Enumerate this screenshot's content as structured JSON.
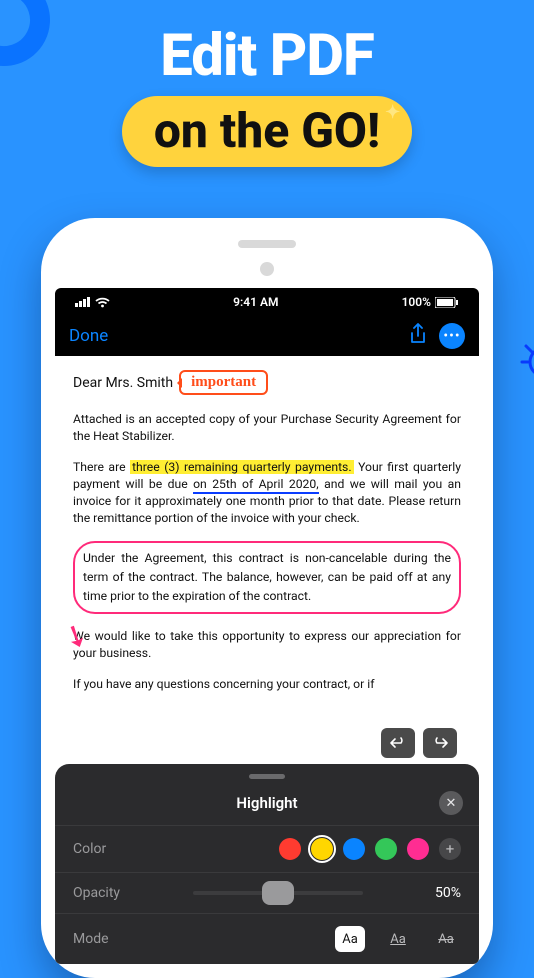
{
  "hero": {
    "line1": "Edit PDF",
    "line2": "on the GO!"
  },
  "statusbar": {
    "time": "9:41 AM",
    "battery_pct": "100%"
  },
  "toolbar": {
    "done": "Done"
  },
  "document": {
    "greeting": "Dear Mrs. Smith",
    "annotation_callout": "important",
    "p1": "Attached is an accepted copy of your Purchase Security Agreement for the Heat Stabilizer.",
    "p2_a": "There are ",
    "p2_hl": "three (3) remaining quarterly payments.",
    "p2_b": " Your first quarterly payment will be due ",
    "p2_ul": "on 25th of April 2020,",
    "p2_c": " and we will mail you an invoice for it approximately one month prior to that date. Please return the remittance portion of the invoice with your check.",
    "p3": "Under the Agreement, this contract is non-cancelable during the term of the contract. The balance, however, can be paid off at any time prior to the expiration of the contract.",
    "p4": "We would like to take this opportunity to express our appreciation for your business.",
    "p5": "If you have any questions concerning your contract, or if"
  },
  "panel": {
    "title": "Highlight",
    "rows": {
      "color_label": "Color",
      "opacity_label": "Opacity",
      "opacity_value": "50%",
      "mode_label": "Mode",
      "mode_a": "Aa",
      "mode_b": "Aa",
      "mode_c": "Aa"
    },
    "colors": [
      "red",
      "yellow",
      "blue",
      "green",
      "pink"
    ],
    "add_label": "+"
  }
}
